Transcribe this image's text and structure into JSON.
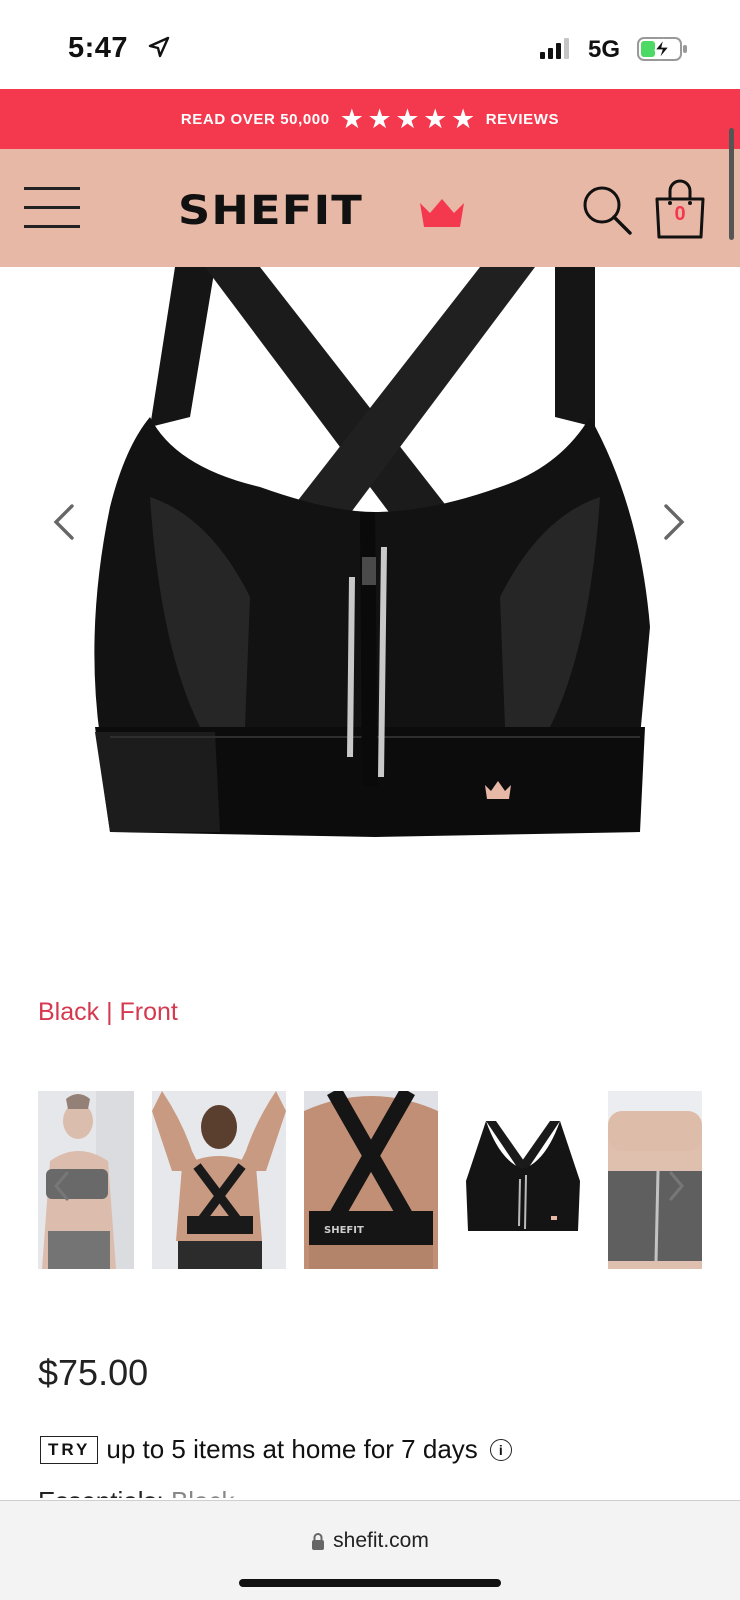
{
  "status_bar": {
    "time": "5:47",
    "network": "5G",
    "icons": [
      "location-arrow-icon",
      "signal-bars-icon",
      "battery-charging-icon"
    ]
  },
  "promo": {
    "prefix": "READ OVER 50,000",
    "suffix": "REVIEWS",
    "rating_stars": 5,
    "color": "#f4394f"
  },
  "header": {
    "logo": "SHEFIT",
    "cart_count": "0",
    "background": "#e8b8a6",
    "accent": "#f4394f",
    "icons": [
      "hamburger-menu-icon",
      "search-icon",
      "shopping-bag-icon"
    ]
  },
  "product": {
    "image_caption": "Black | Front",
    "price": "$75.00",
    "try_badge": "TRY",
    "try_text": "up to 5 items at home for 7 days",
    "cutoff_label": "Essentials:",
    "cutoff_value": "Black"
  },
  "thumbnails": [
    {
      "name": "model-front"
    },
    {
      "name": "model-back-raised-arms"
    },
    {
      "name": "model-back-closeup"
    },
    {
      "name": "product-front-black"
    },
    {
      "name": "model-adjusting-strap"
    }
  ],
  "browser": {
    "url": "shefit.com"
  }
}
